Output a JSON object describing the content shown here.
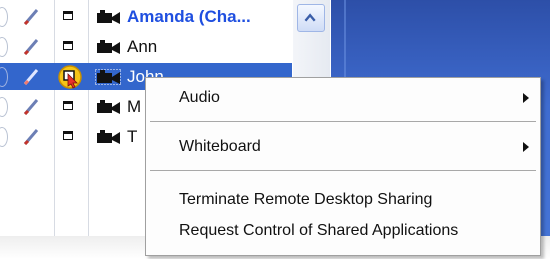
{
  "participants": [
    {
      "name": "Amanda (Cha...",
      "bold": true,
      "selected": false
    },
    {
      "name": "Ann",
      "bold": false,
      "selected": false
    },
    {
      "name": "John",
      "bold": false,
      "selected": true
    },
    {
      "name": "M",
      "bold": false,
      "selected": false
    },
    {
      "name": "T",
      "bold": false,
      "selected": false
    }
  ],
  "icons": {
    "pen": "pen-icon",
    "box": "window-icon",
    "camera": "video-camera-icon",
    "hand": "raise-hand-icon",
    "scroll": "chevron-up-icon",
    "submenu": "submenu-arrow-icon"
  },
  "context_menu": {
    "items": [
      {
        "label": "Audio",
        "submenu": true
      },
      {
        "label": "Whiteboard",
        "submenu": true
      },
      {
        "label": "Terminate Remote Desktop Sharing",
        "submenu": false
      },
      {
        "label": "Request Control of Shared Applications",
        "submenu": false
      }
    ]
  },
  "colors": {
    "selection": "#3366cc",
    "presenter_name": "#1f4fe0",
    "desktop_blue": "#3f6cd0"
  }
}
